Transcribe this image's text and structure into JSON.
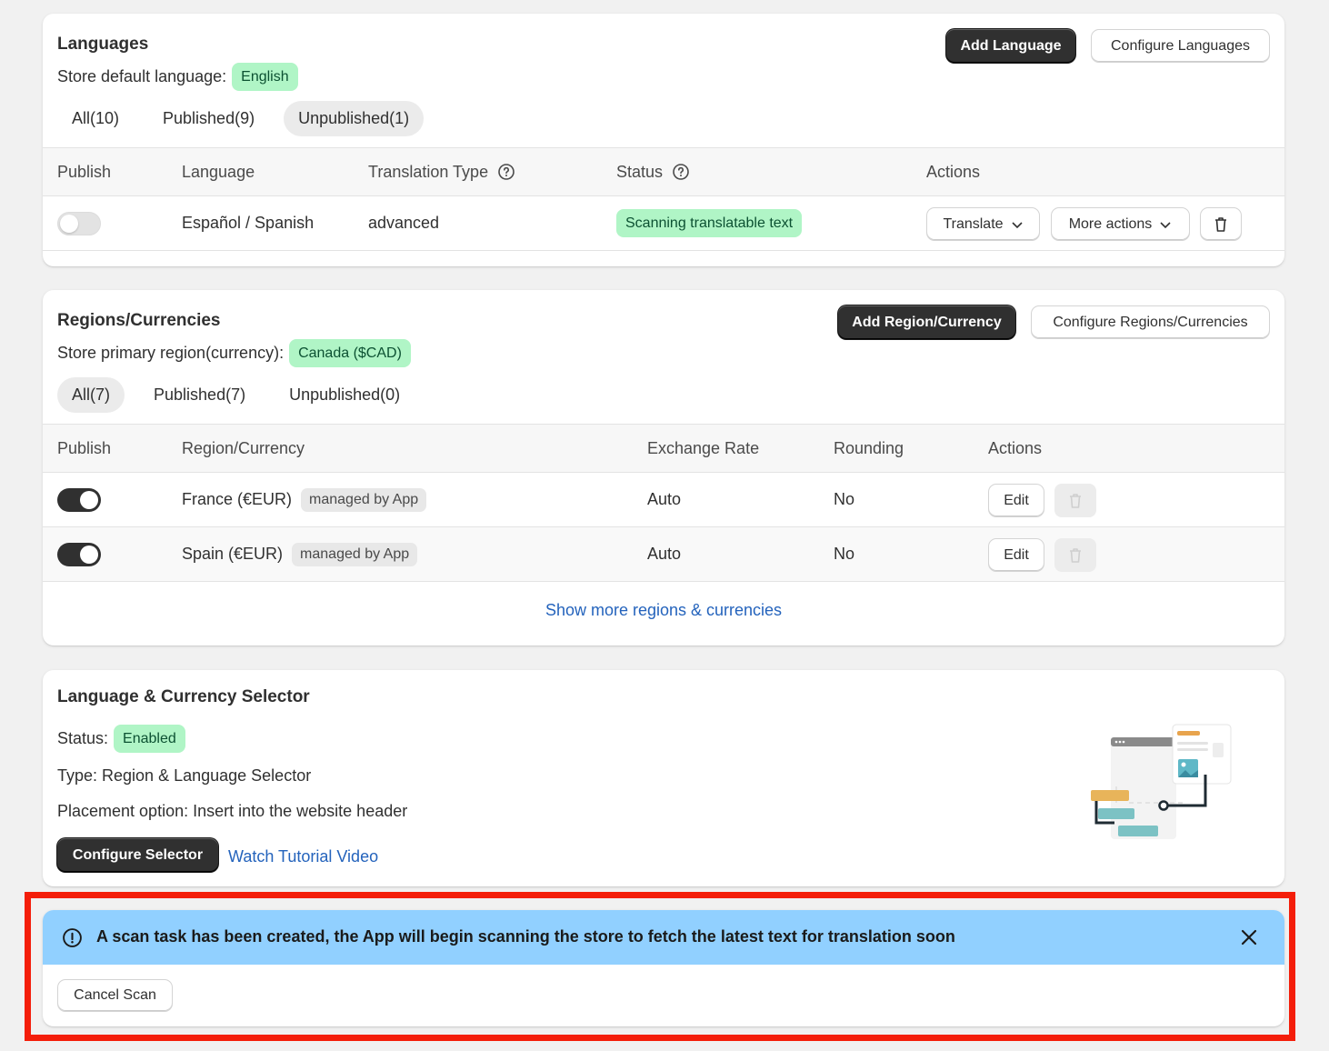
{
  "languages": {
    "title": "Languages",
    "default_label": "Store default language:",
    "default_value": "English",
    "add_button": "Add Language",
    "configure_button": "Configure Languages",
    "tabs": [
      {
        "label": "All(10)",
        "active": false
      },
      {
        "label": "Published(9)",
        "active": false
      },
      {
        "label": "Unpublished(1)",
        "active": true
      }
    ],
    "columns": [
      "Publish",
      "Language",
      "Translation Type",
      "Status",
      "Actions"
    ],
    "rows": [
      {
        "published": false,
        "language": "Español / Spanish",
        "translation_type": "advanced",
        "status": "Scanning translatable text",
        "translate_button": "Translate",
        "more_actions_button": "More actions"
      }
    ]
  },
  "regions": {
    "title": "Regions/Currencies",
    "primary_label": "Store primary region(currency):",
    "primary_value": "Canada ($CAD)",
    "add_button": "Add Region/Currency",
    "configure_button": "Configure Regions/Currencies",
    "tabs": [
      {
        "label": "All(7)",
        "active": true
      },
      {
        "label": "Published(7)",
        "active": false
      },
      {
        "label": "Unpublished(0)",
        "active": false
      }
    ],
    "columns": [
      "Publish",
      "Region/Currency",
      "Exchange Rate",
      "Rounding",
      "Actions"
    ],
    "rows": [
      {
        "published": true,
        "region": "France (€EUR)",
        "tag": "managed by App",
        "exchange_rate": "Auto",
        "rounding": "No",
        "edit_button": "Edit"
      },
      {
        "published": true,
        "region": "Spain (€EUR)",
        "tag": "managed by App",
        "exchange_rate": "Auto",
        "rounding": "No",
        "edit_button": "Edit"
      }
    ],
    "show_more_link": "Show more regions & currencies"
  },
  "selector": {
    "title": "Language & Currency Selector",
    "status_label": "Status:",
    "status_value": "Enabled",
    "type_text": "Type: Region & Language Selector",
    "placement_text": "Placement option: Insert into the website header",
    "configure_button": "Configure Selector",
    "tutorial_link": "Watch Tutorial Video"
  },
  "scan_banner": {
    "message": "A scan task has been created, the App will begin scanning the store to fetch the latest text for translation soon",
    "cancel_button": "Cancel Scan",
    "icon": "info-circle-icon",
    "background": "#91d0ff"
  },
  "colors": {
    "primary_button": "#303030",
    "success_badge": "#b0f5c6",
    "link": "#2463bc",
    "highlight_outline": "#f41e0a"
  }
}
